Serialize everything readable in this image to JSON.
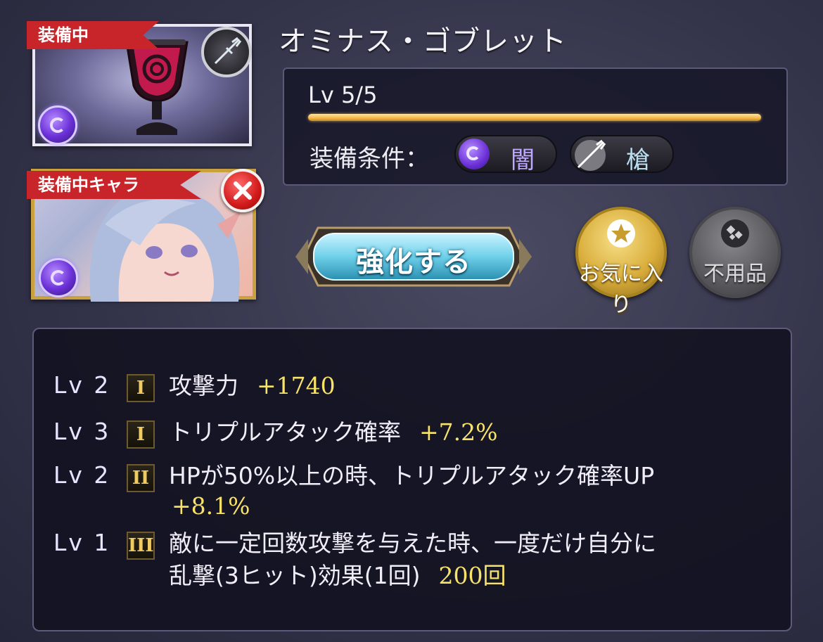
{
  "equipped_item": {
    "ribbon_label": "装備中",
    "element_icon": "dark-element-icon",
    "weapon_icon": "spear-icon"
  },
  "equipped_character": {
    "ribbon_label": "装備中キャラ",
    "element_icon": "dark-element-icon",
    "remove_icon": "close-icon"
  },
  "item": {
    "name": "オミナス・ゴブレット",
    "level_text": "Lv 5/5",
    "level_fraction": 1.0,
    "condition_label": "装備条件：",
    "conditions": [
      {
        "icon": "dark-element-icon",
        "label": "闇"
      },
      {
        "icon": "spear-icon",
        "label": "槍"
      }
    ]
  },
  "actions": {
    "enhance_label": "強化する",
    "favorite_label": "お気に入り",
    "favorite_icon": "star-icon",
    "junk_label": "不用品",
    "junk_icon": "junk-icon"
  },
  "skills": [
    {
      "level": "Lv 2",
      "rank": "I",
      "name": "攻撃力",
      "value": "+1740"
    },
    {
      "level": "Lv 3",
      "rank": "I",
      "name": "トリプルアタック確率",
      "value": "+7.2%"
    },
    {
      "level": "Lv 2",
      "rank": "II",
      "name": "HPが50%以上の時、トリプルアタック確率UP",
      "value": "+8.1%"
    },
    {
      "level": "Lv 1",
      "rank": "III",
      "name": "敵に一定回数攻撃を与えた時、一度だけ自分に",
      "name_line2": "乱撃(3ヒット)効果(1回)",
      "value": "200回"
    }
  ],
  "colors": {
    "ribbon": "#c8252a",
    "level_bar": "#f2b748",
    "skill_value": "#f7e26a",
    "enhance_button": "#7fd6ea"
  }
}
